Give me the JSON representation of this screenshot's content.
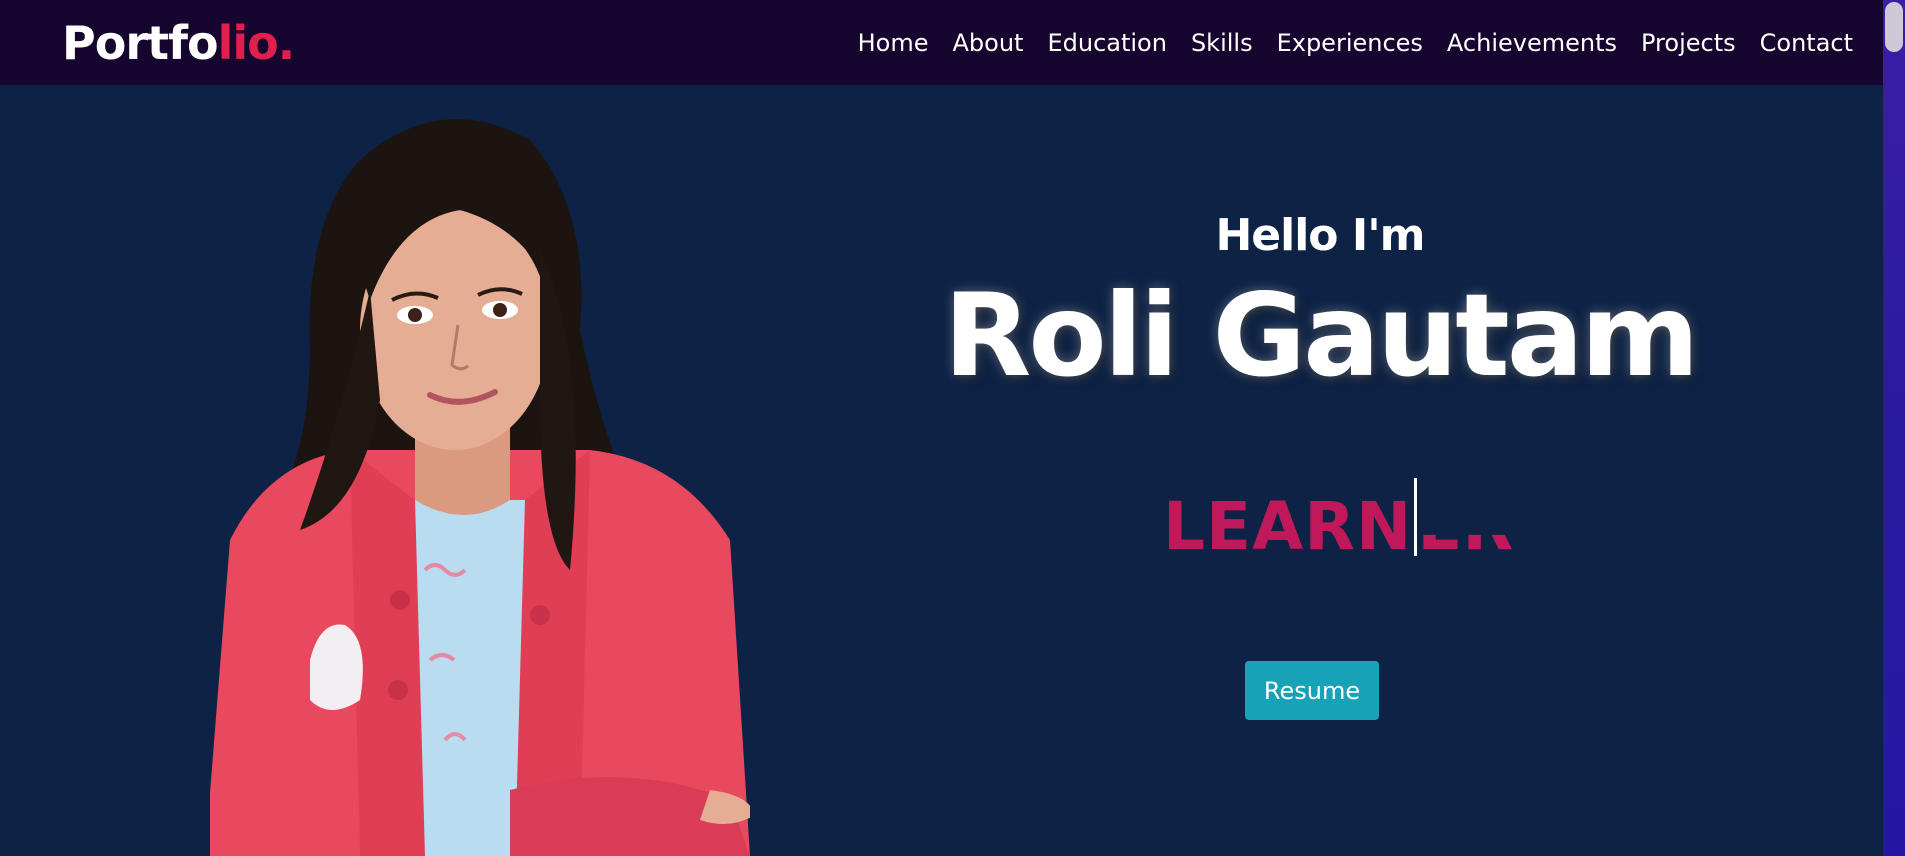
{
  "navbar": {
    "logo_main": "Portfo",
    "logo_accent": "lio.",
    "links": [
      "Home",
      "About",
      "Education",
      "Skills",
      "Experiences",
      "Achievements",
      "Projects",
      "Contact"
    ]
  },
  "hero": {
    "greeting": "Hello I'm",
    "name": "Roli Gautam",
    "typing_text": "LEARN",
    "typing_partial": "ER",
    "resume_label": "Resume"
  },
  "colors": {
    "navbar_bg": "#16052e",
    "hero_bg": "#0d2245",
    "accent_red": "#e01f4d",
    "typing_color": "#c0195a",
    "button_bg": "#17a2b8"
  }
}
